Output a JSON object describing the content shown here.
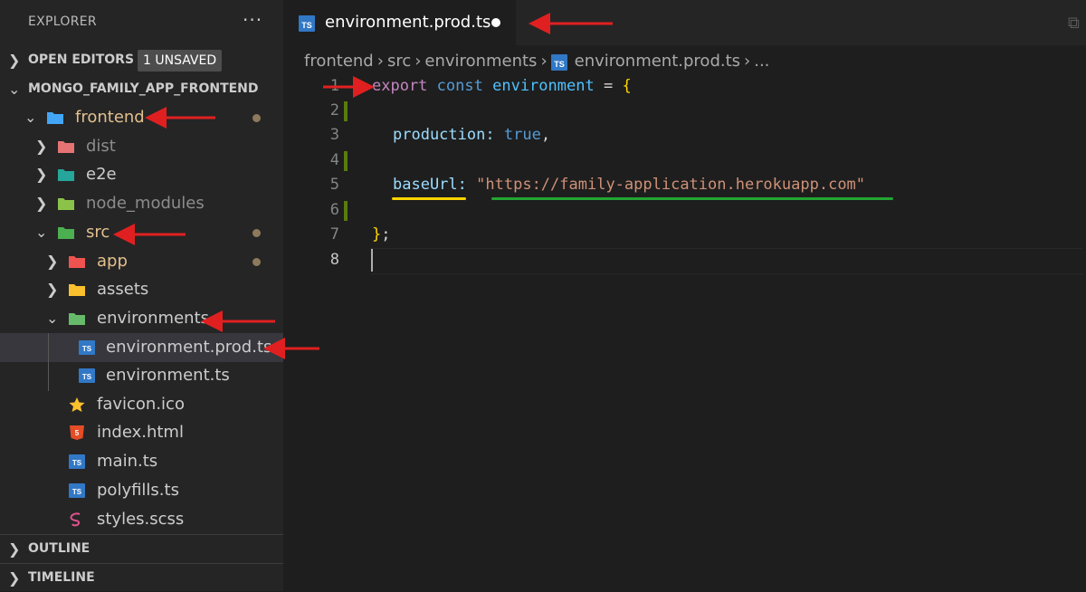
{
  "explorer": {
    "title": "EXPLORER",
    "more_icon": "ellipsis-icon",
    "open_editors": {
      "label": "OPEN EDITORS",
      "badge": "1 UNSAVED"
    },
    "project": {
      "label": "MONGO_FAMILY_APP_FRONTEND"
    },
    "tree": [
      {
        "name": "frontend",
        "type": "folder",
        "expanded": true,
        "modified": true,
        "color": "#e2c08d",
        "icon": "folder-frontend-icon"
      },
      {
        "name": "dist",
        "type": "folder",
        "expanded": false,
        "color": "#8c8c8c",
        "icon": "folder-dist-icon"
      },
      {
        "name": "e2e",
        "type": "folder",
        "expanded": false,
        "color": "#cccccc",
        "icon": "folder-e2e-icon"
      },
      {
        "name": "node_modules",
        "type": "folder",
        "expanded": false,
        "color": "#8c8c8c",
        "icon": "folder-node-icon"
      },
      {
        "name": "src",
        "type": "folder",
        "expanded": true,
        "modified": true,
        "color": "#e2c08d",
        "icon": "folder-src-icon"
      },
      {
        "name": "app",
        "type": "folder",
        "expanded": false,
        "modified": true,
        "color": "#e2c08d",
        "icon": "folder-app-icon"
      },
      {
        "name": "assets",
        "type": "folder",
        "expanded": false,
        "color": "#cccccc",
        "icon": "folder-assets-icon"
      },
      {
        "name": "environments",
        "type": "folder",
        "expanded": true,
        "color": "#cccccc",
        "icon": "folder-environments-icon"
      },
      {
        "name": "environment.prod.ts",
        "type": "file",
        "selected": true,
        "color": "#cccccc",
        "icon": "typescript-icon"
      },
      {
        "name": "environment.ts",
        "type": "file",
        "color": "#cccccc",
        "icon": "typescript-icon"
      },
      {
        "name": "favicon.ico",
        "type": "file",
        "color": "#cccccc",
        "icon": "star-icon"
      },
      {
        "name": "index.html",
        "type": "file",
        "color": "#cccccc",
        "icon": "html5-icon"
      },
      {
        "name": "main.ts",
        "type": "file",
        "color": "#cccccc",
        "icon": "typescript-icon"
      },
      {
        "name": "polyfills.ts",
        "type": "file",
        "color": "#cccccc",
        "icon": "typescript-icon"
      },
      {
        "name": "styles.scss",
        "type": "file",
        "color": "#cccccc",
        "icon": "sass-icon"
      }
    ],
    "outline": {
      "label": "OUTLINE"
    },
    "timeline": {
      "label": "TIMELINE"
    }
  },
  "tab": {
    "label": "environment.prod.ts",
    "unsaved": true
  },
  "breadcrumb": [
    "frontend",
    "src",
    "environments",
    "environment.prod.ts",
    "..."
  ],
  "code": {
    "line_numbers": [
      "1",
      "2",
      "3",
      "4",
      "5",
      "6",
      "7",
      "8"
    ],
    "line1": {
      "kw": "export",
      "kw2": "const",
      "name": "environment",
      "op": "=",
      "brace": "{"
    },
    "line3": {
      "prop": "production",
      "colon": ":",
      "value": "true",
      "comma": ","
    },
    "line5": {
      "prop": "baseUrl",
      "colon": ":",
      "value": "\"https://family-application.herokuapp.com\""
    },
    "line7": {
      "brace": "}",
      "semi": ";"
    }
  },
  "colors": {
    "accent_arrow": "#e02020",
    "modified": "#e2c08d",
    "typescript": "#3178c6"
  }
}
